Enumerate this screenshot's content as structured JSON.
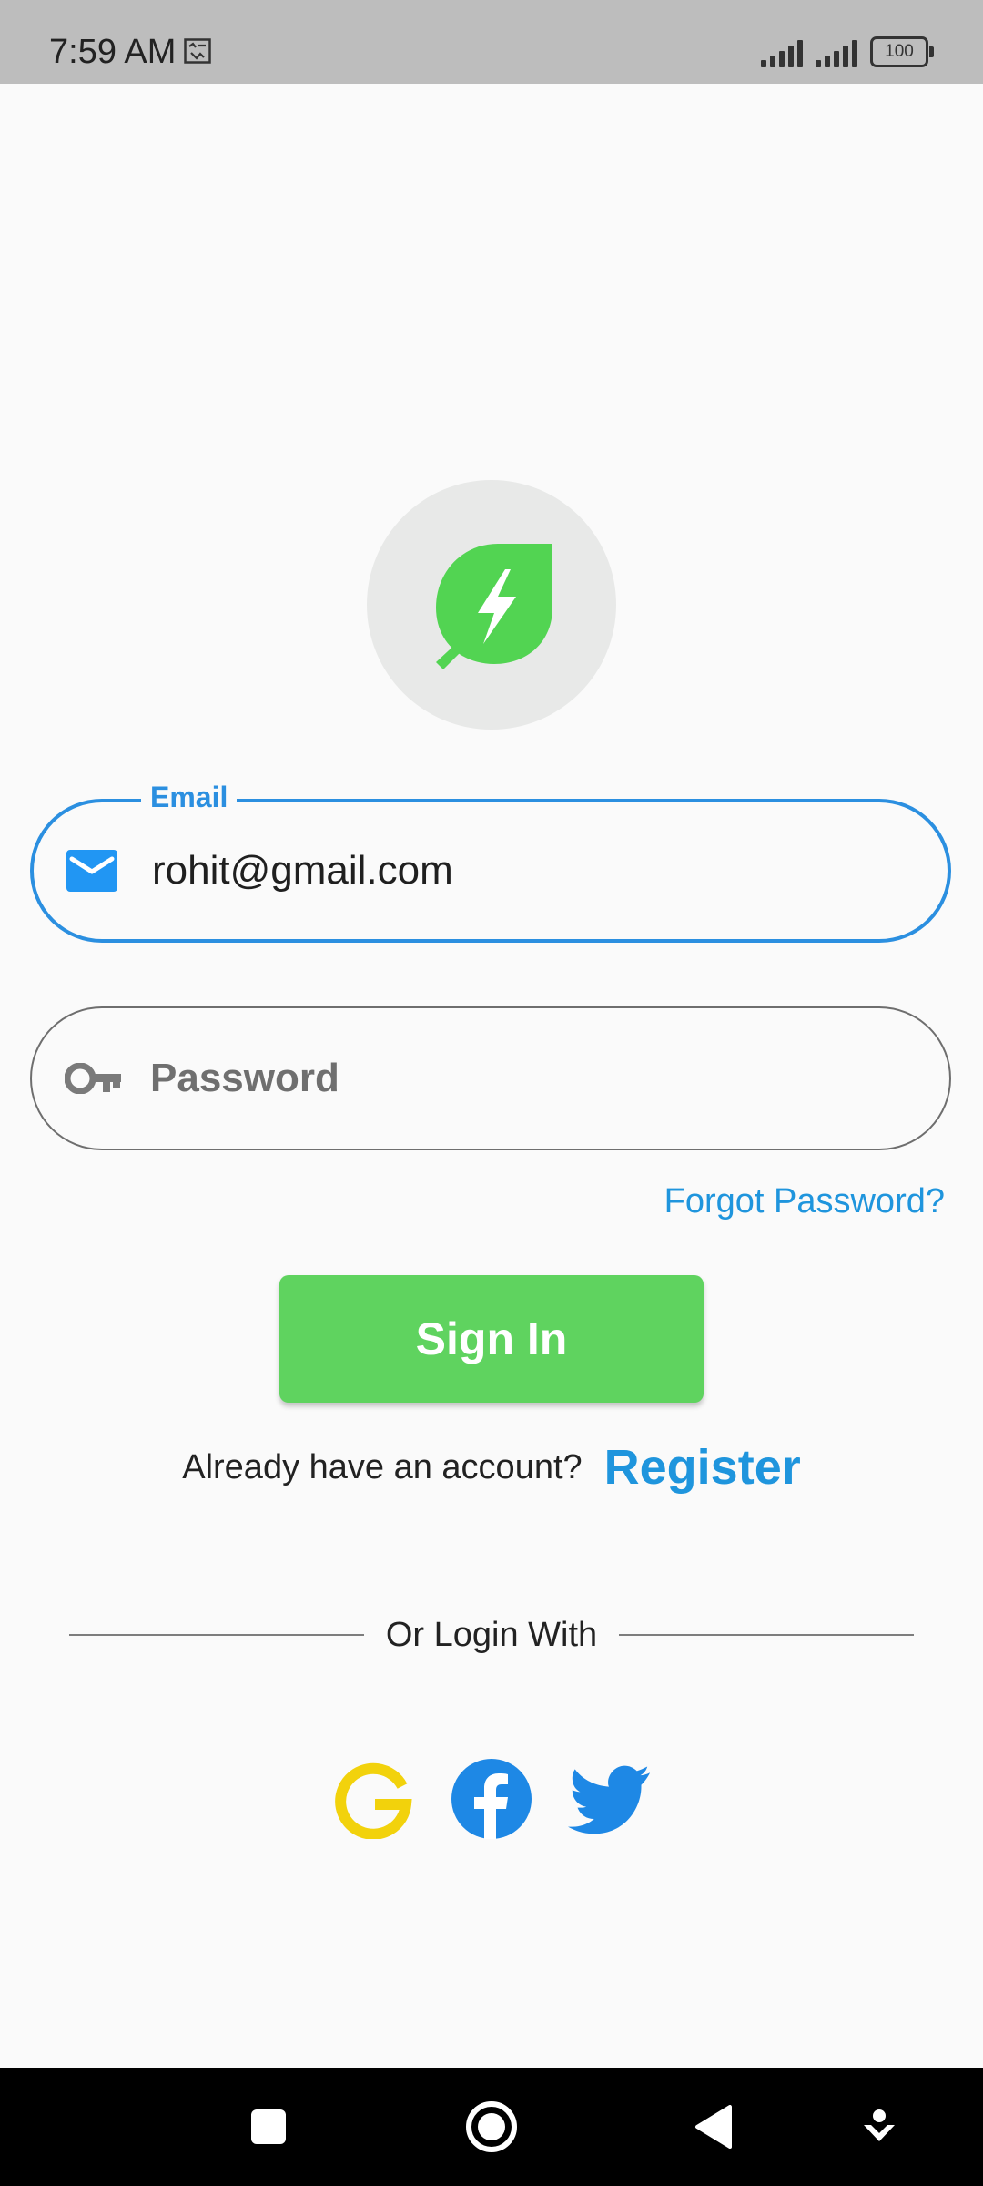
{
  "status_bar": {
    "time": "7:59 AM",
    "notification_icon": "screenshot-icon",
    "signal_icons": [
      "signal-icon",
      "signal-icon"
    ],
    "battery_level": "100"
  },
  "logo": {
    "icon": "leaf-bolt-icon",
    "accent_color": "#52d452"
  },
  "email": {
    "label": "Email",
    "value": "rohit@gmail.com",
    "icon": "mail-icon"
  },
  "password": {
    "placeholder": "Password",
    "icon": "key-icon"
  },
  "forgot_password": "Forgot Password?",
  "sign_in": {
    "label": "Sign In",
    "color": "#5fd35f"
  },
  "account": {
    "prompt": "Already have an account?",
    "register_label": "Register"
  },
  "divider_text": "Or Login With",
  "social": [
    {
      "name": "google",
      "icon": "google-icon",
      "color": "#f2d20c"
    },
    {
      "name": "facebook",
      "icon": "facebook-icon",
      "color": "#1e88e5"
    },
    {
      "name": "twitter",
      "icon": "twitter-icon",
      "color": "#1e88e5"
    }
  ],
  "nav_bar": {
    "buttons": [
      "square-icon",
      "home-circle-icon",
      "back-triangle-icon",
      "download-icon"
    ]
  }
}
